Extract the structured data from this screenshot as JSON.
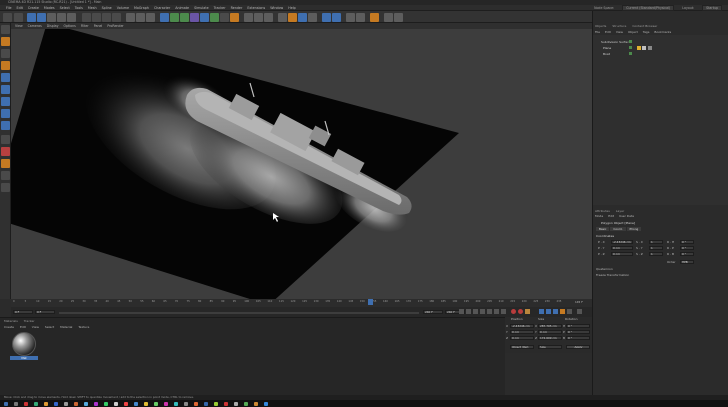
{
  "app": {
    "title": "CINEMA 4D R21.115 Studio (RC-R21) - [Untitled 1 *] - Main"
  },
  "menubar": {
    "items": [
      "File",
      "Edit",
      "Create",
      "Modes",
      "Select",
      "Tools",
      "Mesh",
      "Spline",
      "Volume",
      "MoGraph",
      "Character",
      "Animate",
      "Simulate",
      "Tracker",
      "Render",
      "Extensions",
      "Window",
      "Help"
    ],
    "node_space_label": "Node Space:",
    "node_space_value": "Current (Standard/Physical)",
    "layout_label": "Layout:",
    "layout_value": "Startup"
  },
  "viewport": {
    "menu": [
      "View",
      "Cameras",
      "Display",
      "Options",
      "Filter",
      "Panel",
      "ProRender"
    ]
  },
  "timeline": {
    "ticks": [
      "0",
      "5",
      "10",
      "15",
      "20",
      "25",
      "30",
      "35",
      "40",
      "45",
      "50",
      "55",
      "60",
      "65",
      "70",
      "75",
      "80",
      "85",
      "90",
      "95",
      "100",
      "105",
      "110",
      "115",
      "120",
      "125",
      "130",
      "135",
      "140",
      "145",
      "150",
      "155",
      "160",
      "165",
      "170",
      "175",
      "180",
      "185",
      "190",
      "195",
      "200",
      "205",
      "210",
      "215",
      "220",
      "225",
      "230",
      "235"
    ],
    "current_frame": "145 F",
    "end_frame": "240 F",
    "start_field": "0 F",
    "min_field": "0 F",
    "max_field": "240 F"
  },
  "materials": {
    "tabs": [
      "Materials",
      "Tracker"
    ],
    "menu": [
      "Create",
      "Edit",
      "View",
      "Select",
      "Material",
      "Texture"
    ],
    "swatch_name": "Mat"
  },
  "coordinates": {
    "headers": [
      "Position",
      "Size",
      "Rotation"
    ],
    "rows": [
      {
        "axis_p": "X",
        "pos": "-2.43246 cm",
        "axis_s": "X",
        "size": "287.705 cm",
        "axis_r": "H",
        "rot": "0 °"
      },
      {
        "axis_p": "Y",
        "pos": "0 cm",
        "axis_s": "Y",
        "size": "0 cm",
        "axis_r": "P",
        "rot": "0 °"
      },
      {
        "axis_p": "Z",
        "pos": "0 cm",
        "axis_s": "Z",
        "size": "172.609 cm",
        "axis_r": "B",
        "rot": "0 °"
      }
    ],
    "object_select": "Object (Rel)",
    "size_select": "Size",
    "apply_button": "Apply"
  },
  "objects_panel": {
    "tabs": [
      "Objects",
      "Structure",
      "Content Browser"
    ],
    "menu": [
      "File",
      "Edit",
      "View",
      "Object",
      "Tags",
      "Bookmarks"
    ],
    "rows": [
      "Subdivision Surface",
      "Plane",
      "Boat"
    ]
  },
  "attributes_panel": {
    "tabs": [
      "Attributes",
      "Layer"
    ],
    "menu": [
      "Mode",
      "Edit",
      "User Data"
    ],
    "object_title": "Polygon Object [Plane]",
    "subtabs": [
      "Basic",
      "Coord.",
      "Phong"
    ],
    "section": "Coordinates",
    "fields": [
      {
        "label": "P . X",
        "value": "-2.43246 cm",
        "label2": "S . X",
        "value2": "1",
        "label3": "R . H",
        "value3": "0 °"
      },
      {
        "label": "P . Y",
        "value": "0 cm",
        "label2": "S . Y",
        "value2": "1",
        "label3": "R . P",
        "value3": "0 °"
      },
      {
        "label": "P . Z",
        "value": "0 cm",
        "label2": "S . Z",
        "value2": "1",
        "label3": "R . B",
        "value3": "0 °"
      }
    ],
    "order_label": "Order",
    "order_value": "HPB",
    "quaternion": "Quaternion",
    "freeze": "Freeze Transformation"
  },
  "statusbar": {
    "text": "Move: Click and drag to move elements. Hold down SHIFT to quantize movement / add to the selection in point mode, CTRL to remove."
  }
}
